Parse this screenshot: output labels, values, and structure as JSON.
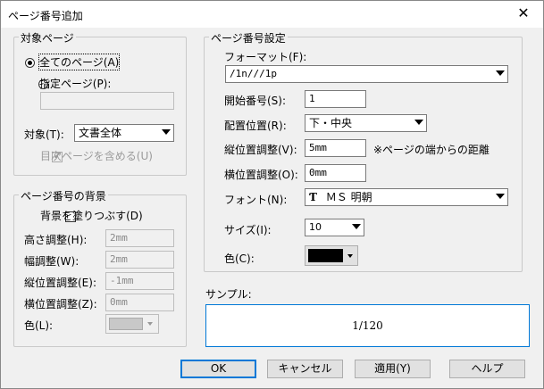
{
  "window": {
    "title": "ページ番号追加",
    "close_glyph": "✕"
  },
  "target_group": {
    "legend": "対象ページ",
    "radio_all": "全てのページ(A)",
    "radio_specified": "指定ページ(P):",
    "specified_value": "",
    "target_label": "対象(T):",
    "target_value": "文書全体",
    "toc_checkbox": "目次ページを含める(U)"
  },
  "background_group": {
    "legend": "ページ番号の背景",
    "fill_checkbox": "背景を塗りつぶす(D)",
    "height_label": "高さ調整(H):",
    "height_value": "2mm",
    "width_label": "幅調整(W):",
    "width_value": "2mm",
    "vpos_label": "縦位置調整(E):",
    "vpos_value": "-1mm",
    "hpos_label": "横位置調整(Z):",
    "hpos_value": "0mm",
    "color_label": "色(L):",
    "color_value": "#c8c8c8"
  },
  "settings_group": {
    "legend": "ページ番号設定",
    "format_label": "フォーマット(F):",
    "format_value": "/1n///1p",
    "start_label": "開始番号(S):",
    "start_value": "1",
    "position_label": "配置位置(R):",
    "position_value": "下・中央",
    "vadjust_label": "縦位置調整(V):",
    "vadjust_value": "5mm",
    "vadjust_note": "※ページの端からの距離",
    "hadjust_label": "横位置調整(O):",
    "hadjust_value": "0mm",
    "font_label": "フォント(N):",
    "font_value": "ＭＳ 明朝",
    "font_icon": "Ƭ",
    "size_label": "サイズ(I):",
    "size_value": "10",
    "color_label": "色(C):",
    "color_value": "#000000"
  },
  "sample": {
    "label": "サンプル:",
    "preview_text": "1/120"
  },
  "buttons": {
    "ok": "OK",
    "cancel": "キャンセル",
    "apply": "適用(Y)",
    "help": "ヘルプ"
  }
}
